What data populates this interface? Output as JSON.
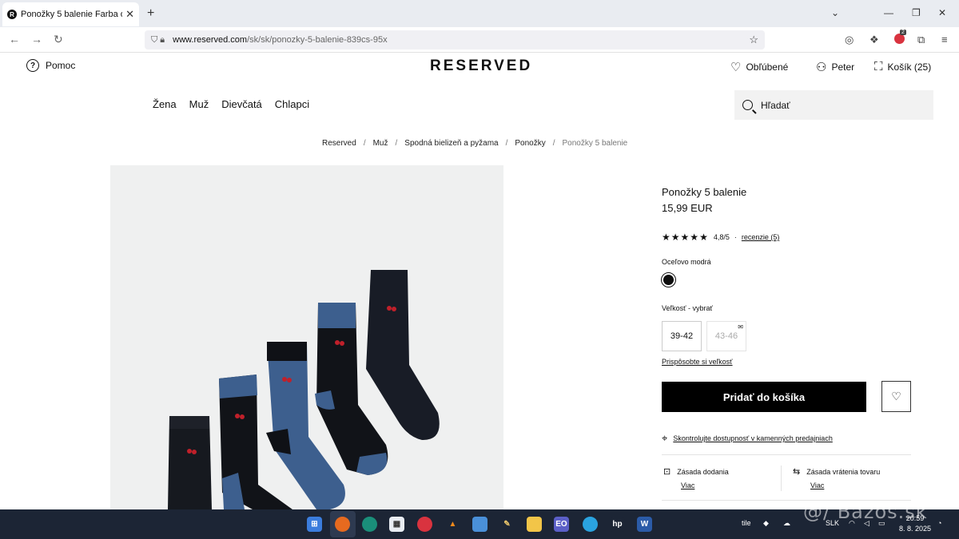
{
  "browser": {
    "tab_title": "Ponožky 5 balenie Farba oceľov",
    "tab_favicon": "R",
    "url_domain": "www.reserved.com",
    "url_path": "/sk/sk/ponozky-5-balenie-839cs-95x",
    "extension_badge": "2"
  },
  "site": {
    "help_label": "Pomoc",
    "logo": "RESERVED",
    "favorites_label": "Obľúbené",
    "user_label": "Peter",
    "cart_label": "Košík (25)",
    "nav": [
      "Žena",
      "Muž",
      "Dievčatá",
      "Chlapci"
    ],
    "search_placeholder": "Hľadať"
  },
  "breadcrumb": [
    "Reserved",
    "Muž",
    "Spodná bielizeň a pyžama",
    "Ponožky",
    "Ponožky 5 balenie"
  ],
  "product": {
    "name": "Ponožky 5 balenie",
    "price": "15,99 EUR",
    "rating_stars": 5,
    "rating": "4,8/5",
    "rating_dot": "·",
    "reviews": "recenzie (5)",
    "color_label": "Oceľovo modrá",
    "swatch_color": "#0d0d0d",
    "size_label": "Veľkosť -  vybrať",
    "sizes": [
      {
        "label": "39-42",
        "available": true
      },
      {
        "label": "43-46",
        "available": false
      }
    ],
    "fit_link": "Prispôsobte si veľkosť",
    "add_to_cart": "Pridať do košíka",
    "availability": "Skontrolujte dostupnosť v kamenných predajniach",
    "delivery_title": "Zásada dodania",
    "delivery_more": "Viac",
    "return_title": "Zásada vrátenia tovaru",
    "return_more": "Viac"
  },
  "colors": {
    "accent": "#000000",
    "sock_blue": "#3d5f8e",
    "sock_dark": "#16191f",
    "taskbar": "#1c2535"
  },
  "taskbar": {
    "tray_text_1": "tile",
    "tray_lang": "SLK",
    "time": "20:59",
    "date": "8. 8. 2025"
  },
  "watermark": "@/ Bazos.sk"
}
